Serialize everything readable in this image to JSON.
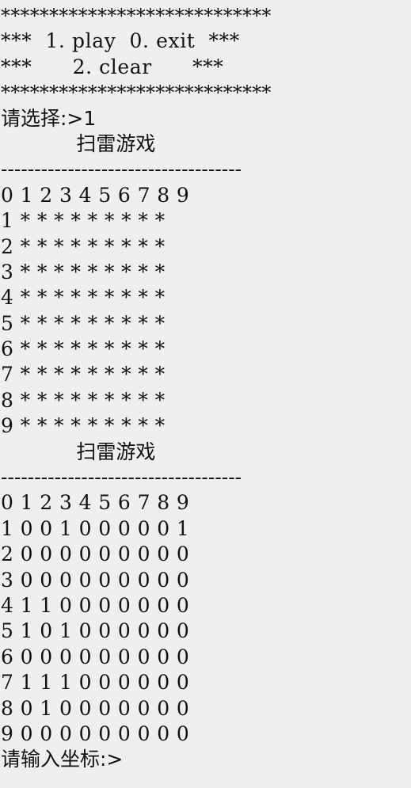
{
  "app": {
    "type": "console-terminal",
    "title": "扫雷游戏",
    "background_color": "#efefee",
    "text_color": "#111111"
  },
  "menu": {
    "border_top": "****************************",
    "line_play_exit": "***  1. play  0. exit  ***",
    "line_clear": "***      2. clear      ***",
    "border_bottom": "****************************",
    "options": [
      {
        "key": "1",
        "label": "play"
      },
      {
        "key": "0",
        "label": "exit"
      },
      {
        "key": "2",
        "label": "clear"
      }
    ]
  },
  "prompt_choice": {
    "label": "请选择:>",
    "value": "1",
    "full": "请选择:>1"
  },
  "board_hidden": {
    "title": "扫雷游戏",
    "title_line": "            扫雷游戏",
    "separator": "------------------------------------",
    "header": "0 1 2 3 4 5 6 7 8 9",
    "rows": [
      "1 * * * * * * * * *",
      "2 * * * * * * * * *",
      "3 * * * * * * * * *",
      "4 * * * * * * * * *",
      "5 * * * * * * * * *",
      "6 * * * * * * * * *",
      "7 * * * * * * * * *",
      "8 * * * * * * * * *",
      "9 * * * * * * * * *"
    ]
  },
  "board_mines": {
    "title": "扫雷游戏",
    "title_line": "            扫雷游戏",
    "separator": "------------------------------------",
    "header": "0 1 2 3 4 5 6 7 8 9",
    "rows": [
      "1 0 0 1 0 0 0 0 0 1",
      "2 0 0 0 0 0 0 0 0 0",
      "3 0 0 0 0 0 0 0 0 0",
      "4 1 1 0 0 0 0 0 0 0",
      "5 1 0 1 0 0 0 0 0 0",
      "6 0 0 0 0 0 0 0 0 0",
      "7 1 1 1 0 0 0 0 0 0",
      "8 0 1 0 0 0 0 0 0 0",
      "9 0 0 0 0 0 0 0 0 0"
    ]
  },
  "prompt_coordinate": {
    "label": "请输入坐标:>",
    "value": ""
  }
}
